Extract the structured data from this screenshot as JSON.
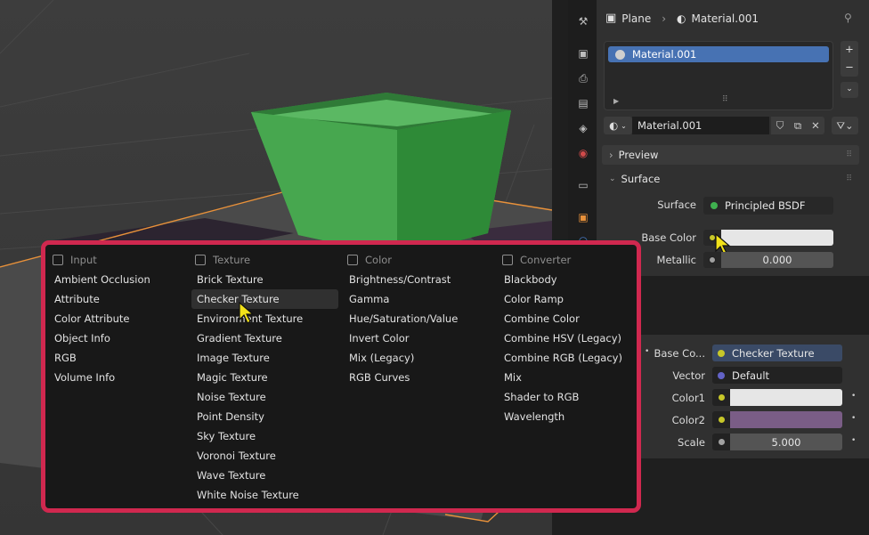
{
  "properties": {
    "breadcrumb": {
      "object": "Plane",
      "material": "Material.001"
    },
    "material_slots": [
      "Material.001"
    ],
    "material_selector": {
      "value": "Material.001"
    },
    "sections": {
      "preview": "Preview",
      "surface": "Surface"
    },
    "surface_row": {
      "label": "Surface",
      "value": "Principled BSDF"
    },
    "base_color_row": {
      "label": "Base Color"
    },
    "metallic_row": {
      "label": "Metallic",
      "value": "0.000"
    }
  },
  "node_panel": {
    "rows": [
      {
        "label": "Base Co...",
        "value": "Checker Texture"
      },
      {
        "label": "Vector",
        "value": "Default"
      },
      {
        "label": "Color1",
        "value": ""
      },
      {
        "label": "Color2",
        "value": ""
      },
      {
        "label": "Scale",
        "value": "5.000"
      }
    ]
  },
  "menu": {
    "columns": [
      {
        "title": "Input",
        "items": [
          "Ambient Occlusion",
          "Attribute",
          "Color Attribute",
          "Object Info",
          "RGB",
          "Volume Info"
        ]
      },
      {
        "title": "Texture",
        "items": [
          "Brick Texture",
          "Checker Texture",
          "Environment Texture",
          "Gradient Texture",
          "Image Texture",
          "Magic Texture",
          "Noise Texture",
          "Point Density",
          "Sky Texture",
          "Voronoi Texture",
          "Wave Texture",
          "White Noise Texture"
        ]
      },
      {
        "title": "Color",
        "items": [
          "Brightness/Contrast",
          "Gamma",
          "Hue/Saturation/Value",
          "Invert Color",
          "Mix (Legacy)",
          "RGB Curves"
        ]
      },
      {
        "title": "Converter",
        "items": [
          "Blackbody",
          "Color Ramp",
          "Combine Color",
          "Combine HSV (Legacy)",
          "Combine RGB (Legacy)",
          "Mix",
          "Shader to RGB",
          "Wavelength"
        ]
      }
    ],
    "highlighted": "Checker Texture"
  },
  "colors": {
    "menu_border": "#d0284f",
    "slot_selected": "#4772b3",
    "socket_yellow": "#c7c729",
    "socket_purple": "#6363c7",
    "socket_grey": "#a1a1a1",
    "color2_swatch": "#7a5d86",
    "color1_swatch": "#e6e6e6",
    "object_green": "#3d9a45"
  }
}
